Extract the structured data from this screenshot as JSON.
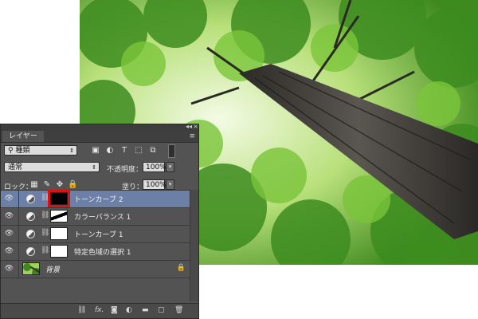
{
  "panel": {
    "tab": "レイヤー",
    "collapse": "◂◂",
    "close": "×",
    "menu": "≡"
  },
  "filter": {
    "kind": "種類"
  },
  "blend": {
    "mode": "通常",
    "opacity_label": "不透明度：",
    "opacity_value": "100%"
  },
  "lock": {
    "label": "ロック：",
    "fill_label": "塗り：",
    "fill_value": "100%"
  },
  "layers": [
    {
      "name": "トーンカーブ 2",
      "selected": true
    },
    {
      "name": "カラーバランス 1",
      "selected": false
    },
    {
      "name": "トーンカーブ 1",
      "selected": false
    },
    {
      "name": "特定色域の選択 1",
      "selected": false
    },
    {
      "name": "背景",
      "selected": false
    }
  ],
  "footer": {
    "fx": "fx."
  }
}
